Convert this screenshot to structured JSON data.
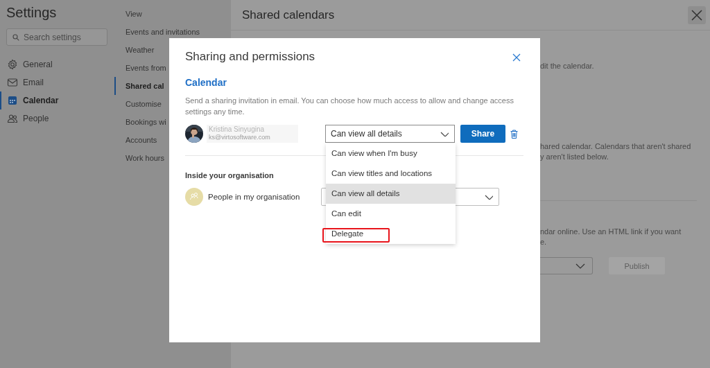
{
  "settings": {
    "title": "Settings",
    "search": {
      "placeholder": "Search settings"
    },
    "nav": [
      {
        "label": "General",
        "selected": false
      },
      {
        "label": "Email",
        "selected": false
      },
      {
        "label": "Calendar",
        "selected": true
      },
      {
        "label": "People",
        "selected": false
      }
    ],
    "subnav": [
      {
        "label": "View",
        "selected": false
      },
      {
        "label": "Events and invitations",
        "selected": false
      },
      {
        "label": "Weather",
        "selected": false
      },
      {
        "label": "Events from",
        "selected": false
      },
      {
        "label": "Shared cal",
        "selected": true
      },
      {
        "label": "Customise",
        "selected": false
      },
      {
        "label": "Bookings wi",
        "selected": false
      },
      {
        "label": "Accounts",
        "selected": false
      },
      {
        "label": "Work hours",
        "selected": false
      }
    ]
  },
  "page": {
    "title": "Shared calendars",
    "text_1": "dit the calendar.",
    "text_2": [
      "hared calendar. Calendars that aren't shared",
      "y aren't listed below."
    ],
    "text_3": [
      "ndar online. Use an HTML link if you want",
      "e."
    ],
    "publish_button": {
      "label": "Publish",
      "disabled": true
    }
  },
  "dialog": {
    "title": "Sharing and permissions",
    "section": "Calendar",
    "description": "Send a sharing invitation in email. You can choose how much access to allow and change access settings any time.",
    "recipient": {
      "name": "Kristina Sinyugina",
      "email": "ks@virtosoftware.com",
      "permission": "Can view all details"
    },
    "share_button": "Share",
    "org_heading": "Inside your organisation",
    "org_row": {
      "label": "People in my organisation"
    },
    "dropdown": {
      "options": [
        {
          "label": "Can view when I'm busy",
          "selected": false,
          "annotated": false
        },
        {
          "label": "Can view titles and locations",
          "selected": false,
          "annotated": false
        },
        {
          "label": "Can view all details",
          "selected": true,
          "annotated": false
        },
        {
          "label": "Can edit",
          "selected": false,
          "annotated": false
        },
        {
          "label": "Delegate",
          "selected": false,
          "annotated": true
        }
      ]
    }
  }
}
